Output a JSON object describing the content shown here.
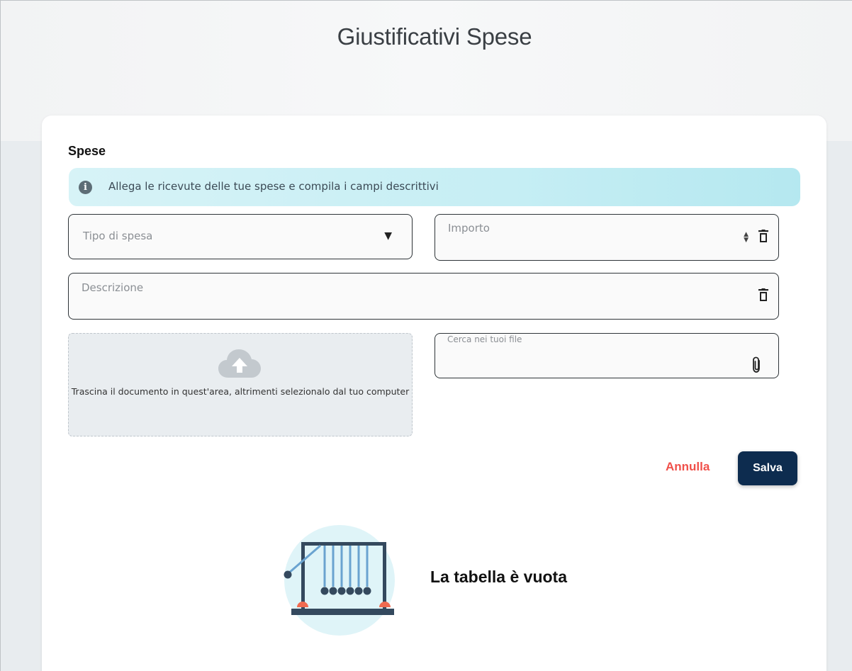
{
  "header": {
    "title": "Giustificativi Spese"
  },
  "section": {
    "title": "Spese",
    "info_text": "Allega le ricevute delle tue spese e compila i campi descrittivi"
  },
  "form": {
    "tipo_spesa": {
      "placeholder": "Tipo di spesa",
      "value": ""
    },
    "importo": {
      "placeholder": "Importo",
      "value": ""
    },
    "descrizione": {
      "placeholder": "Descrizione",
      "value": ""
    },
    "file": {
      "placeholder": "Cerca nei tuoi file",
      "value": ""
    },
    "dropzone_text": "Trascina il documento in quest'area, altrimenti selezionalo dal tuo computer"
  },
  "actions": {
    "cancel_label": "Annulla",
    "save_label": "Salva"
  },
  "table": {
    "empty_message": "La tabella è vuota"
  },
  "colors": {
    "primary": "#0d2c4f",
    "cancel": "#f0504a",
    "info_bg": "#c6eef4"
  },
  "icons": [
    "info-icon",
    "chevron-down-icon",
    "spinner-arrows-icon",
    "trash-icon",
    "cloud-upload-icon",
    "paperclip-icon",
    "newtons-cradle-illustration"
  ]
}
